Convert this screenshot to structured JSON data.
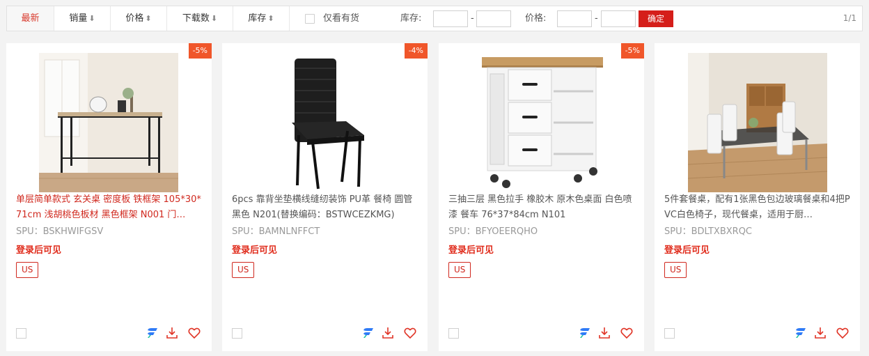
{
  "toolbar": {
    "sort": [
      {
        "label": "最新",
        "arrow": ""
      },
      {
        "label": "销量",
        "arrow": "⬇"
      },
      {
        "label": "价格",
        "arrow": "⬍"
      },
      {
        "label": "下载数",
        "arrow": "⬇"
      },
      {
        "label": "库存",
        "arrow": "⬍"
      }
    ],
    "in_stock_label": "仅看有货",
    "stock_label": "库存:",
    "price_label": "价格:",
    "dash": "-",
    "confirm_label": "确定",
    "page_indicator": "1/1"
  },
  "products": [
    {
      "discount": "-5%",
      "title": "单层简单款式 玄关桌 密度板 铁框架 105*30*71cm 浅胡桃色板材 黑色框架 N001 门…",
      "spu": "SPU：BSKHWIFGSV",
      "login_text": "登录后可见",
      "tag": "US"
    },
    {
      "discount": "-4%",
      "title": "6pcs 靠背坐垫横线缝纫装饰 PU革 餐椅 圆管 黑色 N201(替换编码：BSTWCEZKMG)",
      "spu": "SPU：BAMNLNFFCT",
      "login_text": "登录后可见",
      "tag": "US"
    },
    {
      "discount": "-5%",
      "title": "三抽三层 黑色拉手 橡胶木 原木色桌面 白色喷漆 餐车 76*37*84cm N101",
      "spu": "SPU：BFYOEERQHO",
      "login_text": "登录后可见",
      "tag": "US"
    },
    {
      "discount": "",
      "title": "5件套餐桌，配有1张黑色包边玻璃餐桌和4把PVC白色椅子，现代餐桌，适用于厨…",
      "spu": "SPU：BDLTXBXRQC",
      "login_text": "登录后可见",
      "tag": "US"
    }
  ],
  "colors": {
    "accent": "#d51e1a",
    "discount_bg": "#f0562a",
    "brand_icon": "#2f7bf6"
  },
  "icons": [
    "brand-f-icon",
    "download-icon",
    "heart-icon"
  ]
}
